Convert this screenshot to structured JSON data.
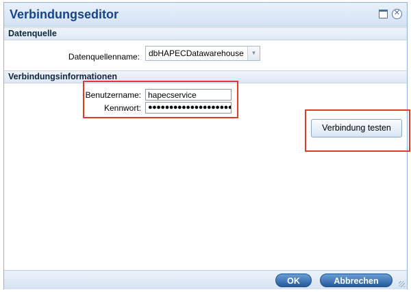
{
  "dialog": {
    "title": "Verbindungseditor",
    "maximize_icon": "maximize-icon",
    "close_icon": "close-icon",
    "close_glyph": "✕"
  },
  "datasource_section": {
    "heading": "Datenquelle",
    "name_label": "Datenquellenname:",
    "name_value": "dbHAPECDatawarehouse",
    "dropdown_glyph": "▼"
  },
  "connection_section": {
    "heading": "Verbindungsinformationen",
    "username_label": "Benutzername:",
    "username_value": "hapecservice",
    "password_label": "Kennwort:",
    "password_value": "●●●●●●●●●●●●●●●●●●●●",
    "test_button": "Verbindung testen"
  },
  "footer": {
    "ok_button": "OK",
    "cancel_button": "Abbrechen"
  },
  "colors": {
    "title": "#16438f",
    "highlight": "#e03a2a",
    "primary_button": "#255a9c"
  }
}
